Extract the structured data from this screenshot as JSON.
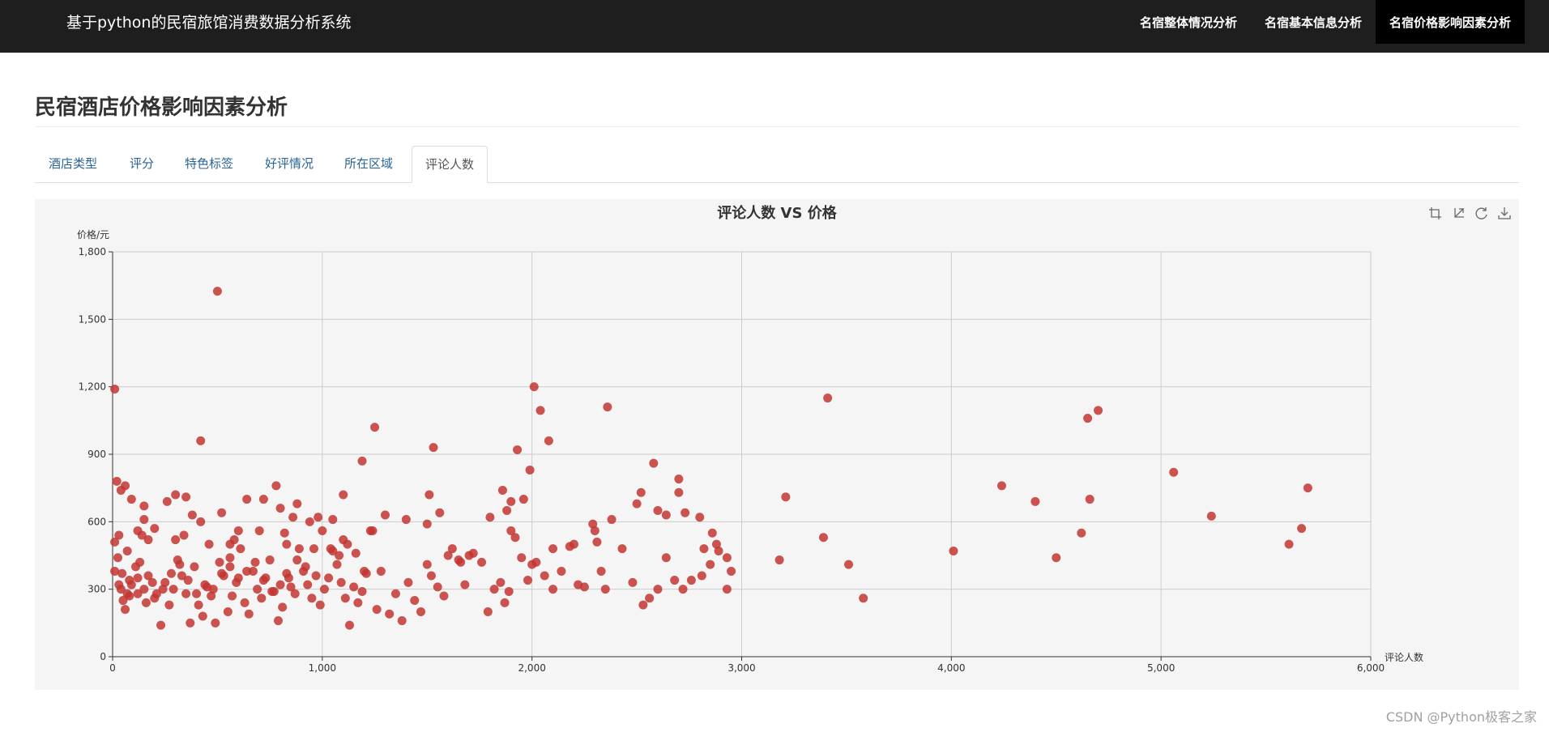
{
  "header": {
    "brand": "基于python的民宿旅馆消费数据分析系统",
    "nav": [
      {
        "label": "名宿整体情况分析",
        "active": false
      },
      {
        "label": "名宿基本信息分析",
        "active": false
      },
      {
        "label": "名宿价格影响因素分析",
        "active": true
      }
    ]
  },
  "page": {
    "title": "民宿酒店价格影响因素分析"
  },
  "tabs": [
    {
      "label": "酒店类型",
      "active": false
    },
    {
      "label": "评分",
      "active": false
    },
    {
      "label": "特色标签",
      "active": false
    },
    {
      "label": "好评情况",
      "active": false
    },
    {
      "label": "所在区域",
      "active": false
    },
    {
      "label": "评论人数",
      "active": true
    }
  ],
  "toolbox": [
    "zoom-icon",
    "zoom-reset-icon",
    "restore-icon",
    "download-icon"
  ],
  "chart_data": {
    "type": "scatter",
    "title": "评论人数 VS 价格",
    "xlabel": "评论人数",
    "ylabel": "价格/元",
    "xlim": [
      0,
      6000
    ],
    "ylim": [
      0,
      1800
    ],
    "xticks": [
      "0",
      "1,000",
      "2,000",
      "3,000",
      "4,000",
      "5,000",
      "6,000"
    ],
    "yticks": [
      "0",
      "300",
      "600",
      "900",
      "1,200",
      "1,500",
      "1,800"
    ],
    "grid": true,
    "color": "#c23531",
    "points": [
      [
        10,
        1190
      ],
      [
        500,
        1625
      ],
      [
        420,
        960
      ],
      [
        20,
        780
      ],
      [
        40,
        740
      ],
      [
        60,
        760
      ],
      [
        10,
        510
      ],
      [
        30,
        540
      ],
      [
        70,
        470
      ],
      [
        90,
        700
      ],
      [
        120,
        350
      ],
      [
        150,
        610
      ],
      [
        150,
        670
      ],
      [
        200,
        570
      ],
      [
        260,
        690
      ],
      [
        300,
        720
      ],
      [
        350,
        710
      ],
      [
        380,
        630
      ],
      [
        420,
        600
      ],
      [
        520,
        640
      ],
      [
        560,
        500
      ],
      [
        600,
        560
      ],
      [
        640,
        700
      ],
      [
        720,
        700
      ],
      [
        780,
        760
      ],
      [
        800,
        660
      ],
      [
        820,
        550
      ],
      [
        860,
        620
      ],
      [
        880,
        680
      ],
      [
        940,
        600
      ],
      [
        980,
        620
      ],
      [
        1050,
        610
      ],
      [
        1100,
        720
      ],
      [
        1190,
        870
      ],
      [
        1250,
        1020
      ],
      [
        1300,
        630
      ],
      [
        1400,
        610
      ],
      [
        1510,
        720
      ],
      [
        1530,
        930
      ],
      [
        1560,
        640
      ],
      [
        1700,
        450
      ],
      [
        1800,
        620
      ],
      [
        1860,
        740
      ],
      [
        1880,
        650
      ],
      [
        1900,
        690
      ],
      [
        1930,
        920
      ],
      [
        1960,
        700
      ],
      [
        1990,
        830
      ],
      [
        2010,
        1200
      ],
      [
        2040,
        1095
      ],
      [
        2080,
        960
      ],
      [
        2360,
        1110
      ],
      [
        2500,
        680
      ],
      [
        2520,
        730
      ],
      [
        2580,
        860
      ],
      [
        2600,
        650
      ],
      [
        2640,
        630
      ],
      [
        2700,
        790
      ],
      [
        2700,
        730
      ],
      [
        2730,
        640
      ],
      [
        2800,
        620
      ],
      [
        2820,
        480
      ],
      [
        2860,
        550
      ],
      [
        2880,
        500
      ],
      [
        2930,
        440
      ],
      [
        2950,
        380
      ],
      [
        3180,
        430
      ],
      [
        3210,
        710
      ],
      [
        3390,
        530
      ],
      [
        3410,
        1150
      ],
      [
        3510,
        410
      ],
      [
        3580,
        260
      ],
      [
        4010,
        470
      ],
      [
        4240,
        760
      ],
      [
        4400,
        690
      ],
      [
        4500,
        440
      ],
      [
        4620,
        550
      ],
      [
        4650,
        1060
      ],
      [
        4660,
        700
      ],
      [
        4700,
        1095
      ],
      [
        5060,
        820
      ],
      [
        5240,
        625
      ],
      [
        5610,
        500
      ],
      [
        5670,
        570
      ],
      [
        5700,
        750
      ],
      [
        10,
        380
      ],
      [
        30,
        320
      ],
      [
        40,
        300
      ],
      [
        50,
        250
      ],
      [
        60,
        210
      ],
      [
        70,
        280
      ],
      [
        80,
        270
      ],
      [
        90,
        320
      ],
      [
        110,
        400
      ],
      [
        130,
        420
      ],
      [
        150,
        300
      ],
      [
        170,
        360
      ],
      [
        190,
        330
      ],
      [
        210,
        280
      ],
      [
        230,
        140
      ],
      [
        250,
        330
      ],
      [
        270,
        230
      ],
      [
        290,
        300
      ],
      [
        310,
        430
      ],
      [
        330,
        360
      ],
      [
        350,
        280
      ],
      [
        370,
        150
      ],
      [
        390,
        400
      ],
      [
        410,
        230
      ],
      [
        430,
        180
      ],
      [
        450,
        310
      ],
      [
        470,
        270
      ],
      [
        490,
        150
      ],
      [
        510,
        420
      ],
      [
        530,
        360
      ],
      [
        550,
        200
      ],
      [
        570,
        270
      ],
      [
        590,
        330
      ],
      [
        610,
        480
      ],
      [
        630,
        240
      ],
      [
        650,
        190
      ],
      [
        670,
        380
      ],
      [
        690,
        300
      ],
      [
        710,
        260
      ],
      [
        730,
        350
      ],
      [
        750,
        430
      ],
      [
        770,
        290
      ],
      [
        790,
        160
      ],
      [
        810,
        220
      ],
      [
        830,
        370
      ],
      [
        850,
        310
      ],
      [
        870,
        280
      ],
      [
        890,
        480
      ],
      [
        910,
        380
      ],
      [
        930,
        320
      ],
      [
        950,
        260
      ],
      [
        970,
        360
      ],
      [
        990,
        230
      ],
      [
        1010,
        300
      ],
      [
        1030,
        350
      ],
      [
        1050,
        470
      ],
      [
        1070,
        410
      ],
      [
        1090,
        330
      ],
      [
        1110,
        260
      ],
      [
        1130,
        140
      ],
      [
        1150,
        310
      ],
      [
        1170,
        240
      ],
      [
        1190,
        290
      ],
      [
        1210,
        370
      ],
      [
        1230,
        560
      ],
      [
        1260,
        210
      ],
      [
        1280,
        380
      ],
      [
        1320,
        190
      ],
      [
        1350,
        280
      ],
      [
        1380,
        160
      ],
      [
        1410,
        330
      ],
      [
        1440,
        250
      ],
      [
        1470,
        200
      ],
      [
        1500,
        410
      ],
      [
        1520,
        360
      ],
      [
        1550,
        310
      ],
      [
        1580,
        270
      ],
      [
        1620,
        480
      ],
      [
        1650,
        430
      ],
      [
        1680,
        320
      ],
      [
        1720,
        460
      ],
      [
        1760,
        420
      ],
      [
        1790,
        200
      ],
      [
        1820,
        300
      ],
      [
        1850,
        330
      ],
      [
        1870,
        240
      ],
      [
        1890,
        290
      ],
      [
        1920,
        530
      ],
      [
        1950,
        440
      ],
      [
        1980,
        340
      ],
      [
        2020,
        420
      ],
      [
        2060,
        360
      ],
      [
        2100,
        300
      ],
      [
        2140,
        380
      ],
      [
        2180,
        490
      ],
      [
        2220,
        320
      ],
      [
        2250,
        310
      ],
      [
        2290,
        590
      ],
      [
        2310,
        510
      ],
      [
        2330,
        380
      ],
      [
        2350,
        300
      ],
      [
        2380,
        610
      ],
      [
        2430,
        480
      ],
      [
        2480,
        330
      ],
      [
        2530,
        230
      ],
      [
        2560,
        260
      ],
      [
        2600,
        300
      ],
      [
        2640,
        440
      ],
      [
        2680,
        340
      ],
      [
        2720,
        300
      ],
      [
        2760,
        340
      ],
      [
        2810,
        360
      ],
      [
        2850,
        410
      ],
      [
        2890,
        470
      ],
      [
        2930,
        300
      ],
      [
        1040,
        480
      ],
      [
        1080,
        450
      ],
      [
        1120,
        500
      ],
      [
        1160,
        460
      ],
      [
        1200,
        380
      ],
      [
        960,
        480
      ],
      [
        920,
        400
      ],
      [
        880,
        430
      ],
      [
        840,
        350
      ],
      [
        800,
        320
      ],
      [
        760,
        290
      ],
      [
        720,
        340
      ],
      [
        680,
        420
      ],
      [
        640,
        380
      ],
      [
        600,
        350
      ],
      [
        560,
        400
      ],
      [
        520,
        370
      ],
      [
        480,
        300
      ],
      [
        440,
        320
      ],
      [
        400,
        280
      ],
      [
        360,
        340
      ],
      [
        320,
        410
      ],
      [
        280,
        370
      ],
      [
        240,
        300
      ],
      [
        200,
        260
      ],
      [
        160,
        240
      ],
      [
        120,
        280
      ],
      [
        80,
        340
      ],
      [
        45,
        370
      ],
      [
        25,
        440
      ],
      [
        120,
        560
      ],
      [
        140,
        540
      ],
      [
        170,
        520
      ],
      [
        300,
        520
      ],
      [
        340,
        540
      ],
      [
        460,
        500
      ],
      [
        560,
        440
      ],
      [
        580,
        520
      ],
      [
        700,
        560
      ],
      [
        830,
        500
      ],
      [
        1000,
        560
      ],
      [
        1100,
        520
      ],
      [
        1240,
        560
      ],
      [
        1600,
        450
      ],
      [
        1500,
        590
      ],
      [
        1660,
        420
      ],
      [
        1900,
        560
      ],
      [
        2000,
        410
      ],
      [
        2200,
        500
      ],
      [
        2100,
        480
      ],
      [
        2300,
        560
      ]
    ]
  },
  "watermark": "CSDN @Python极客之家"
}
